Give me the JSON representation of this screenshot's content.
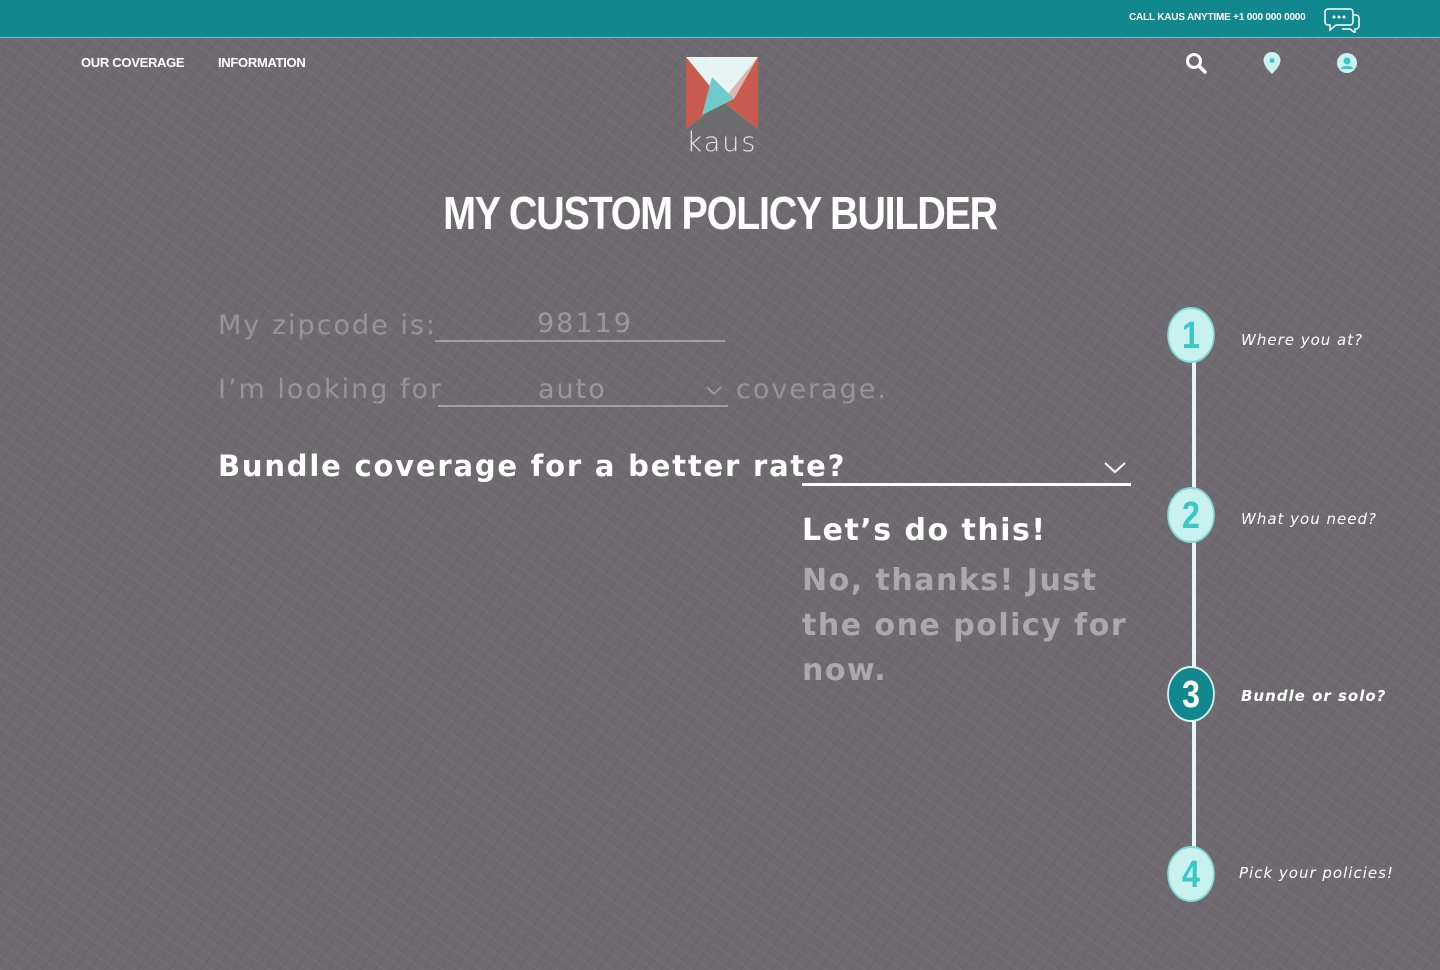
{
  "topbar": {
    "call_text": "CALL KAUS ANYTIME +1 000 000 0000",
    "chat_icon": "chat-bubbles-icon"
  },
  "nav": {
    "coverage": "OUR COVERAGE",
    "information": "INFORMATION"
  },
  "logo": {
    "word": "kaus"
  },
  "header_icons": [
    "search-icon",
    "location-pin-icon",
    "user-icon"
  ],
  "title": "MY CUSTOM POLICY BUILDER",
  "form": {
    "zip_label": "My zipcode is:",
    "zip_value": "98119",
    "looking_label": "I’m looking for",
    "looking_value": "auto",
    "coverage_suffix": "coverage.",
    "bundle_label": "Bundle coverage for a better rate?",
    "bundle_value": "",
    "option_yes": "Let’s do this!",
    "option_no": "No, thanks! Just the one policy for now."
  },
  "steps": [
    {
      "number": "1",
      "label": "Where you at?",
      "active": false
    },
    {
      "number": "2",
      "label": "What you need?",
      "active": false
    },
    {
      "number": "3",
      "label": "Bundle or solo?",
      "active": true
    },
    {
      "number": "4",
      "label": "Pick your policies!",
      "active": false
    }
  ],
  "colors": {
    "teal": "#10888d",
    "step_fill": "#c9f1f0",
    "step_text": "#3cc6c6",
    "background": "#6f6a70"
  }
}
